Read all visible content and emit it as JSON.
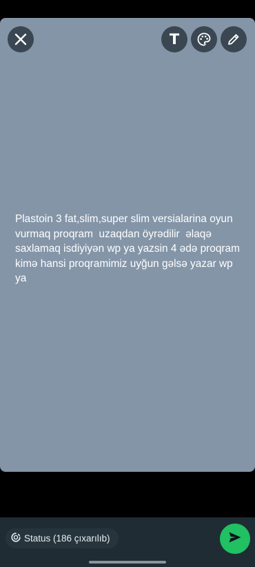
{
  "toolbar": {
    "text_tool_label": "T"
  },
  "status": {
    "text": "Plastoin 3 fat,slim,super slim versialarina oyun vurmaq proqram  uzaqdan öyrədilir  əlaqə saxlamaq isdiyiyən wp ya yazsin 4 ədə proqram kimə hansi proqramimiz uyğun gəlsə yazar wp ya",
    "background_color": "#8495a8"
  },
  "footer": {
    "audience_label": "Status (186 çıxarılıb)",
    "send_color": "#21c063"
  },
  "icons": [
    "close-icon",
    "text-icon",
    "palette-icon",
    "pencil-icon",
    "status-icon",
    "send-icon"
  ]
}
